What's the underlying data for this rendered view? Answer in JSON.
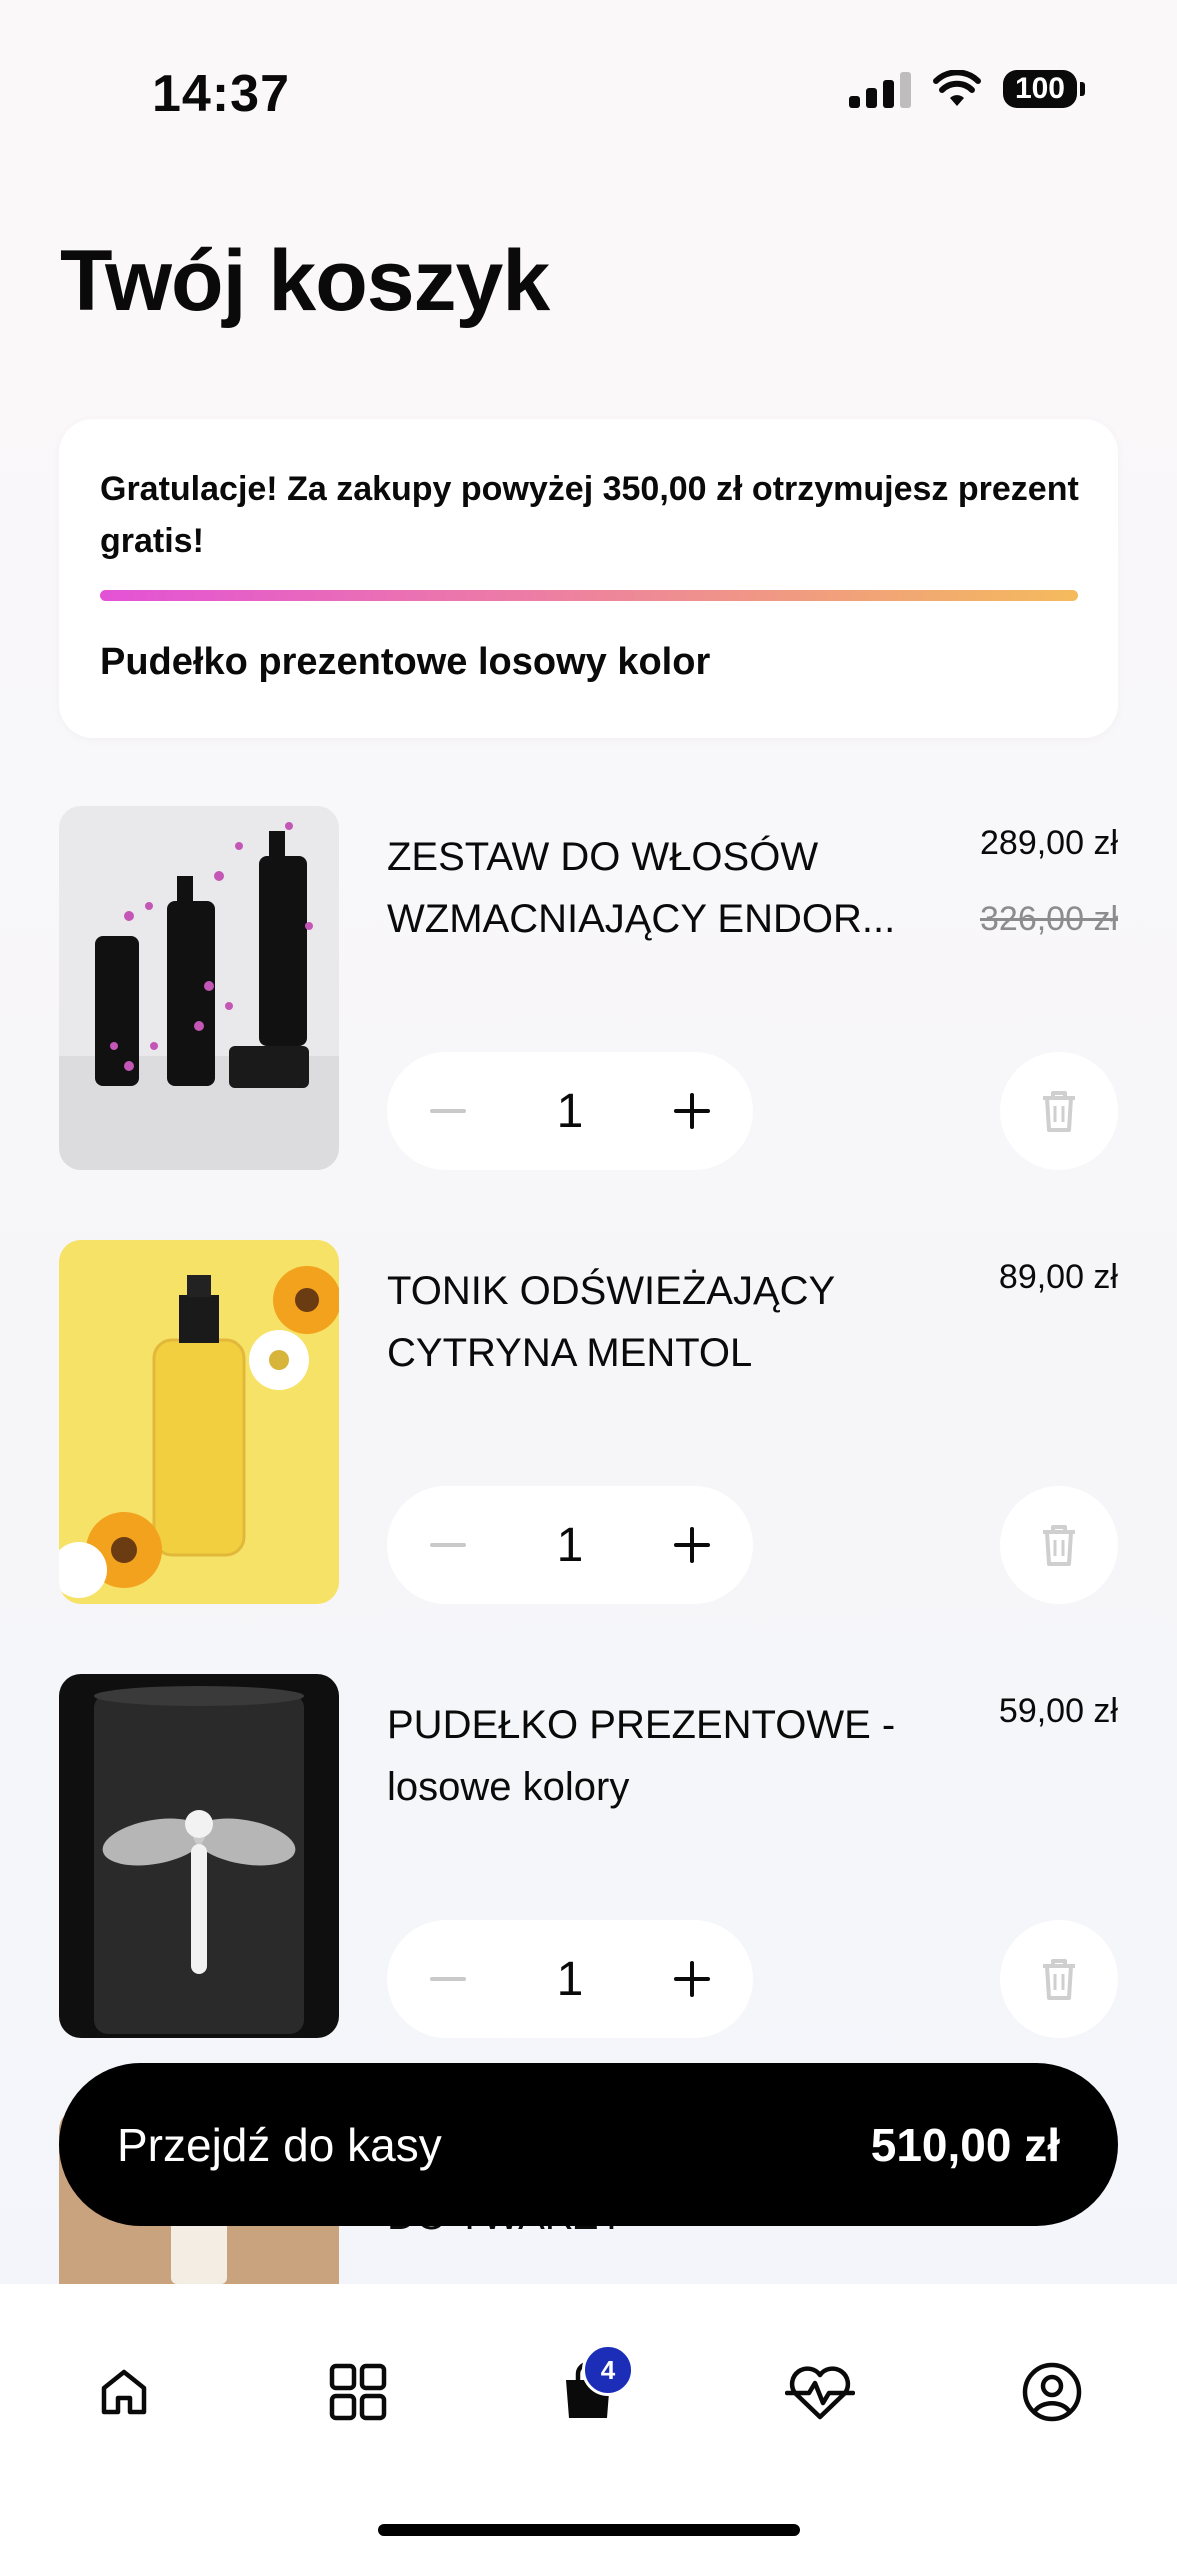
{
  "status_bar": {
    "time": "14:37",
    "battery": "100"
  },
  "page": {
    "title": "Twój koszyk"
  },
  "promo": {
    "message": "Gratulacje! Za zakupy powyżej 350,00 zł otrzymujesz prezent gratis!",
    "progress": 1.0,
    "gift_name": "Pudełko prezentowe losowy kolor"
  },
  "items": [
    {
      "name": "ZESTAW DO WŁOSÓW WZMACNIAJĄCY ENDOR...",
      "price": "289,00 zł",
      "old_price": "326,00 zł",
      "quantity": "1"
    },
    {
      "name": "TONIK ODŚWIEŻAJĄCY CYTRYNA MENTOL",
      "price": "89,00 zł",
      "quantity": "1"
    },
    {
      "name": "PUDEŁKO PREZENTOWE - losowe kolory",
      "price": "59,00 zł",
      "quantity": "1"
    }
  ],
  "partial_item": {
    "name_fragment": "DO TWARZY"
  },
  "checkout": {
    "label": "Przejdź do kasy",
    "total": "510,00 zł"
  },
  "tabbar": {
    "items": [
      {
        "icon": "home-icon"
      },
      {
        "icon": "grid-icon"
      },
      {
        "icon": "bag-icon",
        "badge": "4",
        "active": true
      },
      {
        "icon": "heart-pulse-icon"
      },
      {
        "icon": "account-icon"
      }
    ]
  },
  "colors": {
    "accent_badge": "#1c2eb8",
    "progress_start": "#e352d6",
    "progress_end": "#f4bb5c"
  }
}
